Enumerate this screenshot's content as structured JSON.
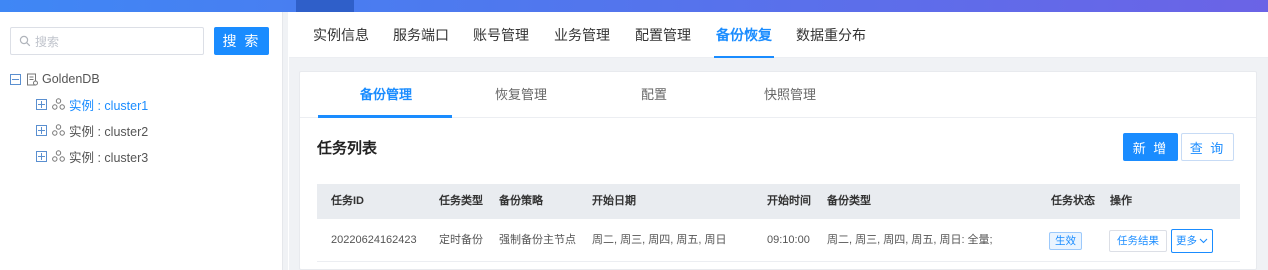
{
  "colors": {
    "primary": "#1a8cff",
    "topbar_start": "#3f87f5",
    "topbar_end": "#6b63e6",
    "table_header_bg": "#e9ecf0",
    "content_bg": "#f0f2f5"
  },
  "sidebar": {
    "search": {
      "placeholder": "搜索",
      "button_label": "搜 索",
      "icon": "search-icon"
    },
    "tree": {
      "root": {
        "label": "GoldenDB",
        "icon": "database-icon",
        "expanded": true
      },
      "children": [
        {
          "label": "实例 : cluster1",
          "icon": "cluster-icon",
          "expanded": false,
          "selected": true
        },
        {
          "label": "实例 : cluster2",
          "icon": "cluster-icon",
          "expanded": false,
          "selected": false
        },
        {
          "label": "实例 : cluster3",
          "icon": "cluster-icon",
          "expanded": false,
          "selected": false
        }
      ]
    }
  },
  "nav": {
    "tabs": [
      {
        "label": "实例信息",
        "active": false
      },
      {
        "label": "服务端口",
        "active": false
      },
      {
        "label": "账号管理",
        "active": false
      },
      {
        "label": "业务管理",
        "active": false
      },
      {
        "label": "配置管理",
        "active": false
      },
      {
        "label": "备份恢复",
        "active": true
      },
      {
        "label": "数据重分布",
        "active": false
      }
    ]
  },
  "subtabs": [
    {
      "label": "备份管理",
      "active": true
    },
    {
      "label": "恢复管理",
      "active": false
    },
    {
      "label": "配置",
      "active": false
    },
    {
      "label": "快照管理",
      "active": false
    }
  ],
  "task_section": {
    "title": "任务列表",
    "add_label": "新 增",
    "query_label": "查 询"
  },
  "table": {
    "columns": [
      "任务ID",
      "任务类型",
      "备份策略",
      "开始日期",
      "开始时间",
      "备份类型",
      "任务状态",
      "操作"
    ],
    "rows": [
      {
        "id": "20220624162423",
        "type": "定时备份",
        "strategy": "强制备份主节点",
        "start_date": "周二, 周三, 周四, 周五, 周日",
        "start_time": "09:10:00",
        "backup_type": "周二, 周三, 周四, 周五, 周日: 全量;",
        "status": "生效",
        "actions": {
          "result_label": "任务结果",
          "more_label": "更多",
          "more_icon": "chevron-down-icon"
        }
      }
    ]
  }
}
